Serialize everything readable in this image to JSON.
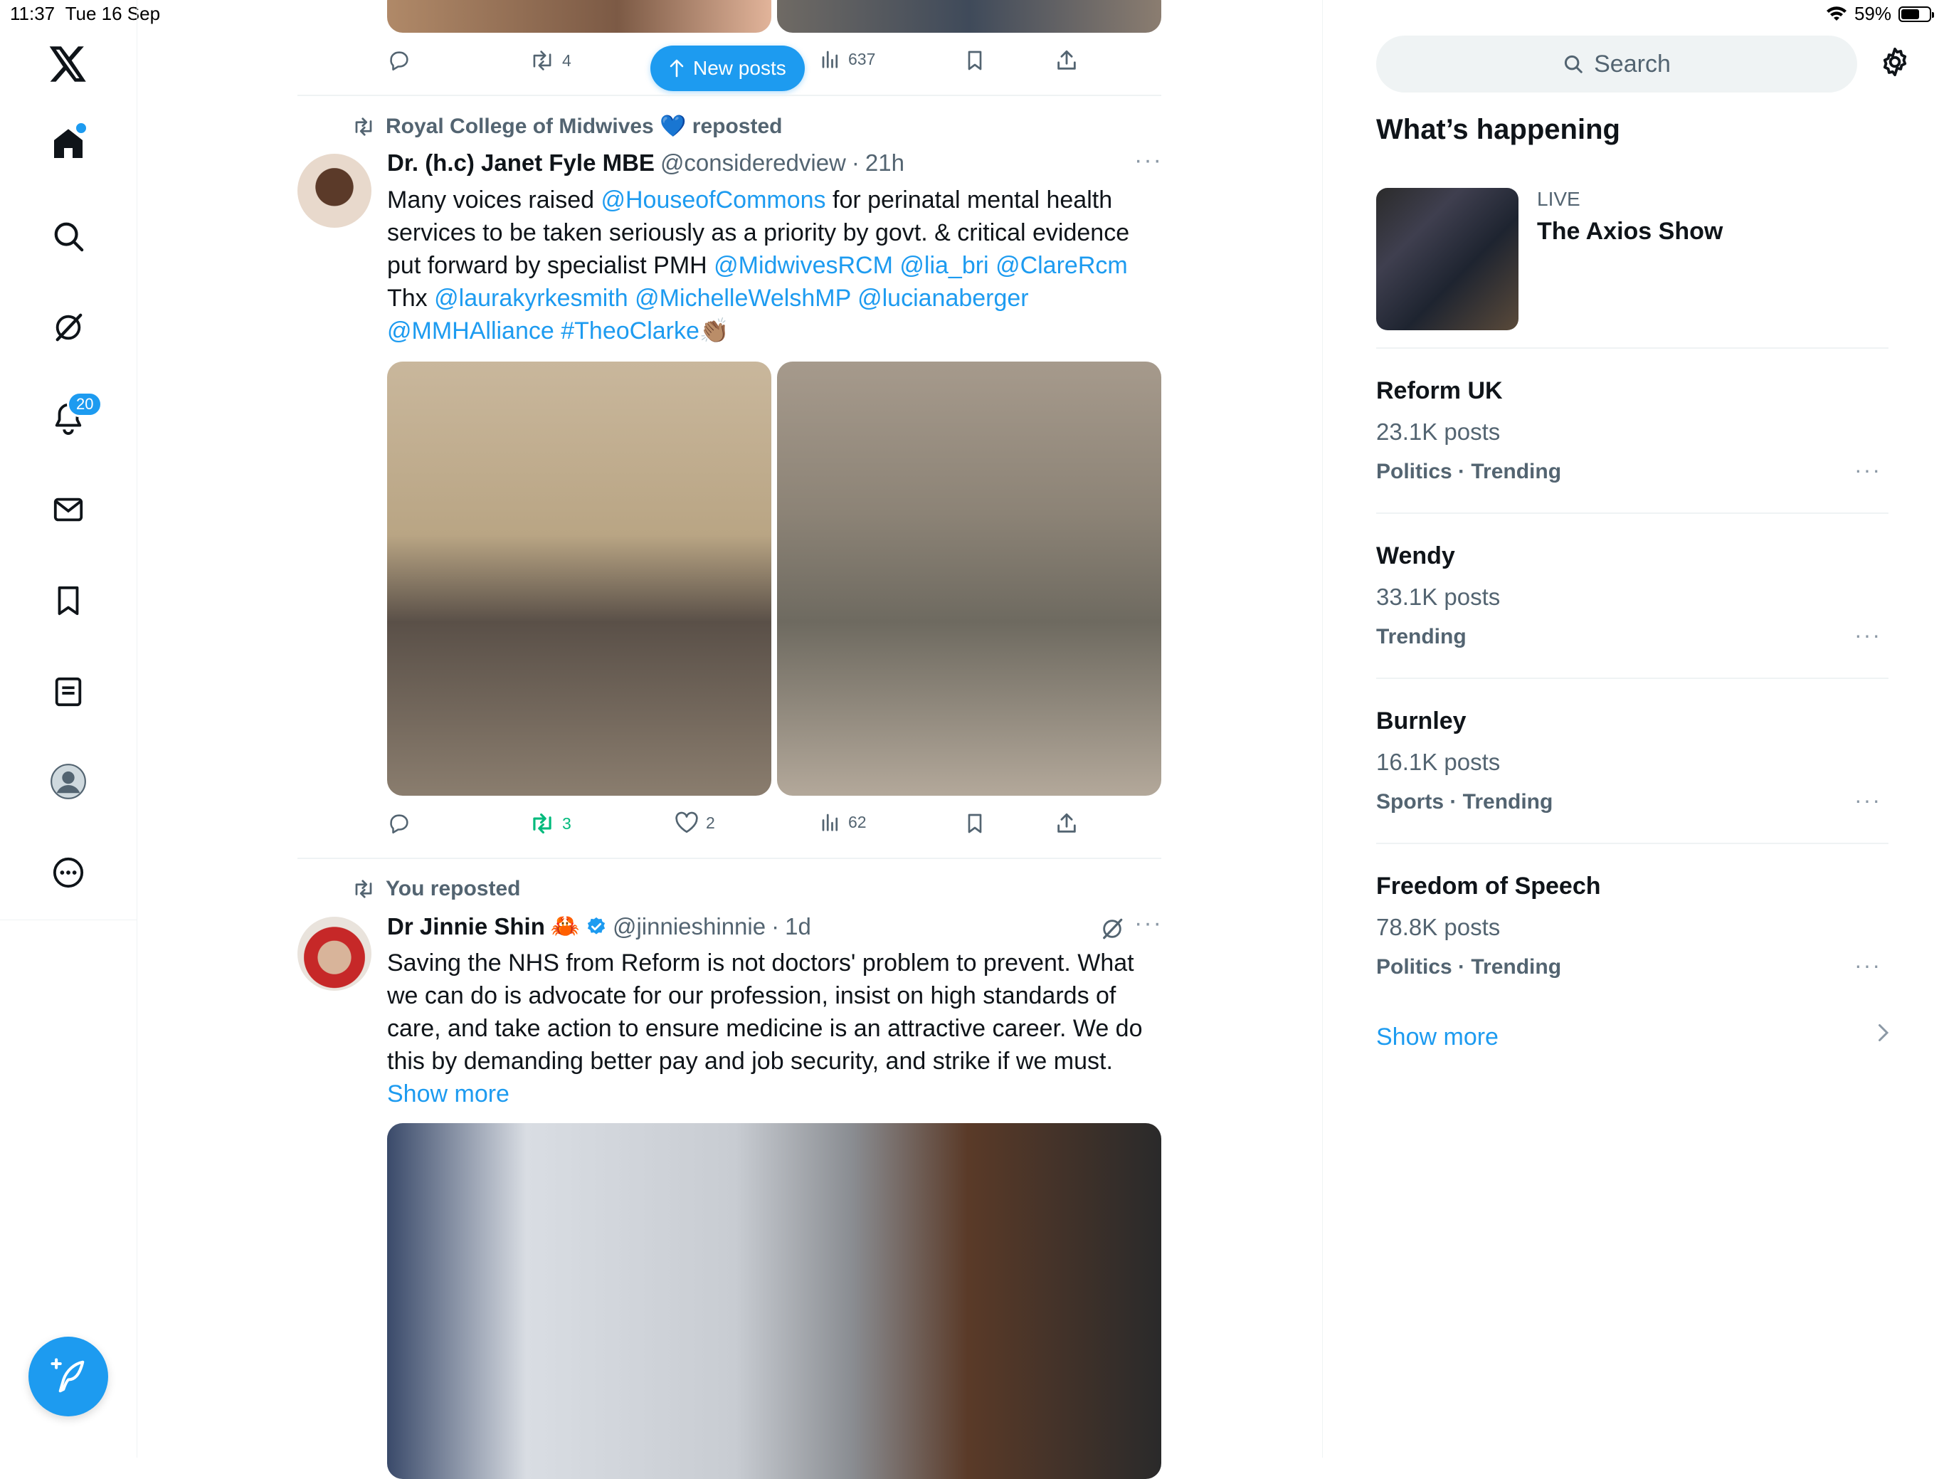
{
  "status_bar": {
    "time": "11:37",
    "date": "Tue 16 Sep",
    "battery": "59%",
    "battery_level": 0.59
  },
  "nav": {
    "notifications_badge": "20",
    "items": [
      "x-logo-icon",
      "home-icon",
      "search-icon",
      "grok-icon",
      "notifications-icon",
      "messages-icon",
      "bookmarks-icon",
      "lists-icon",
      "profile-icon",
      "more-icon"
    ]
  },
  "new_posts_label": "New posts",
  "top_tweet_actions": {
    "reposts": "4",
    "views": "637"
  },
  "tweets": [
    {
      "repost_by": "Royal College of Midwives",
      "repost_emoji": "💙",
      "repost_suffix": "reposted",
      "name": "Dr. (h.c) Janet Fyle MBE",
      "handle": "@consideredview",
      "sep": "·",
      "time": "21h",
      "text_parts": [
        {
          "t": "Many voices raised ",
          "link": false
        },
        {
          "t": "@HouseofCommons",
          "link": true
        },
        {
          "t": " for perinatal mental health services to be taken seriously as a priority by govt. & critical evidence put forward by specialist PMH ",
          "link": false
        },
        {
          "t": "@MidwivesRCM",
          "link": true
        },
        {
          "t": " ",
          "link": false
        },
        {
          "t": "@lia_bri",
          "link": true
        },
        {
          "t": " ",
          "link": false
        },
        {
          "t": "@ClareRcm",
          "link": true
        },
        {
          "t": " Thx ",
          "link": false
        },
        {
          "t": "@laurakyrkesmith",
          "link": true
        },
        {
          "t": " ",
          "link": false
        },
        {
          "t": "@MichelleWelshMP",
          "link": true
        },
        {
          "t": " ",
          "link": false
        },
        {
          "t": "@lucianaberger",
          "link": true
        },
        {
          "t": " ",
          "link": false
        },
        {
          "t": "@MMHAlliance",
          "link": true
        },
        {
          "t": " ",
          "link": false
        },
        {
          "t": "#TheoClarke",
          "link": true
        },
        {
          "t": "👏🏽",
          "link": false
        }
      ],
      "reposts": "3",
      "likes": "2",
      "views": "62"
    },
    {
      "repost_by": "You reposted",
      "name": "Dr Jinnie Shin",
      "name_emoji": "🦀",
      "handle": "@jinnieshinnie",
      "sep": "·",
      "time": "1d",
      "text": "Saving the NHS from Reform is not doctors' problem to prevent. What we can do is advocate for our profession, insist on high standards of care, and take action to ensure medicine is an attractive career. We do this by demanding better pay and job security, and strike if we must.",
      "show_more": "Show more"
    }
  ],
  "right": {
    "search_placeholder": "Search",
    "section_title": "What’s happening",
    "live": {
      "label": "LIVE",
      "title": "The Axios Show"
    },
    "trends": [
      {
        "name": "Reform UK",
        "posts": "23.1K posts",
        "category": "Politics · Trending"
      },
      {
        "name": "Wendy",
        "posts": "33.1K posts",
        "category": "Trending"
      },
      {
        "name": "Burnley",
        "posts": "16.1K posts",
        "category": "Sports · Trending"
      },
      {
        "name": "Freedom of Speech",
        "posts": "78.8K posts",
        "category": "Politics · Trending"
      }
    ],
    "show_more": "Show more"
  },
  "colors": {
    "accent": "#1d9bf0",
    "repost_green": "#00ba7c",
    "secondary_text": "#536471",
    "divider": "#eff3f4"
  }
}
